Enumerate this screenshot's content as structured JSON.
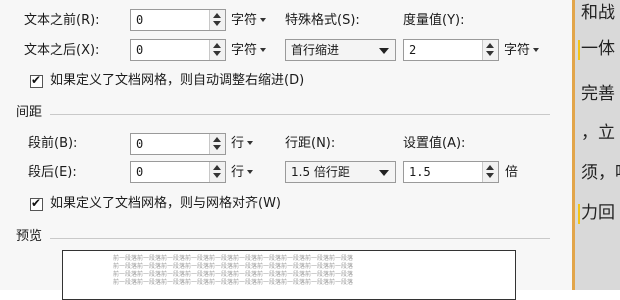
{
  "indent": {
    "before_text": {
      "label": "文本之前(R):",
      "value": "0",
      "unit": "字符"
    },
    "after_text": {
      "label": "文本之后(X):",
      "value": "0",
      "unit": "字符"
    },
    "special_format": {
      "label": "特殊格式(S):",
      "value": "首行缩进"
    },
    "measure": {
      "label": "度量值(Y):",
      "value": "2",
      "unit": "字符"
    },
    "grid_checkbox": {
      "label": "如果定义了文档网格，则自动调整右缩进(D)",
      "checked": true
    }
  },
  "spacing": {
    "title": "间距",
    "before": {
      "label": "段前(B):",
      "value": "0",
      "unit": "行"
    },
    "after": {
      "label": "段后(E):",
      "value": "0",
      "unit": "行"
    },
    "line_spacing": {
      "label": "行距(N):",
      "value": "1.5 倍行距"
    },
    "set_value": {
      "label": "设置值(A):",
      "value": "1.5",
      "unit": "倍"
    },
    "grid_checkbox": {
      "label": "如果定义了文档网格，则与网格对齐(W)",
      "checked": true
    }
  },
  "preview": {
    "title": "预览",
    "sample_text": "前一段落前一段落前一段落前一段落前一段落前一段落前一段落前一段落前一段落前一段落"
  },
  "document": {
    "lines": [
      "和战",
      "一体",
      "完善",
      "，立",
      "须，呗",
      "力回"
    ]
  }
}
